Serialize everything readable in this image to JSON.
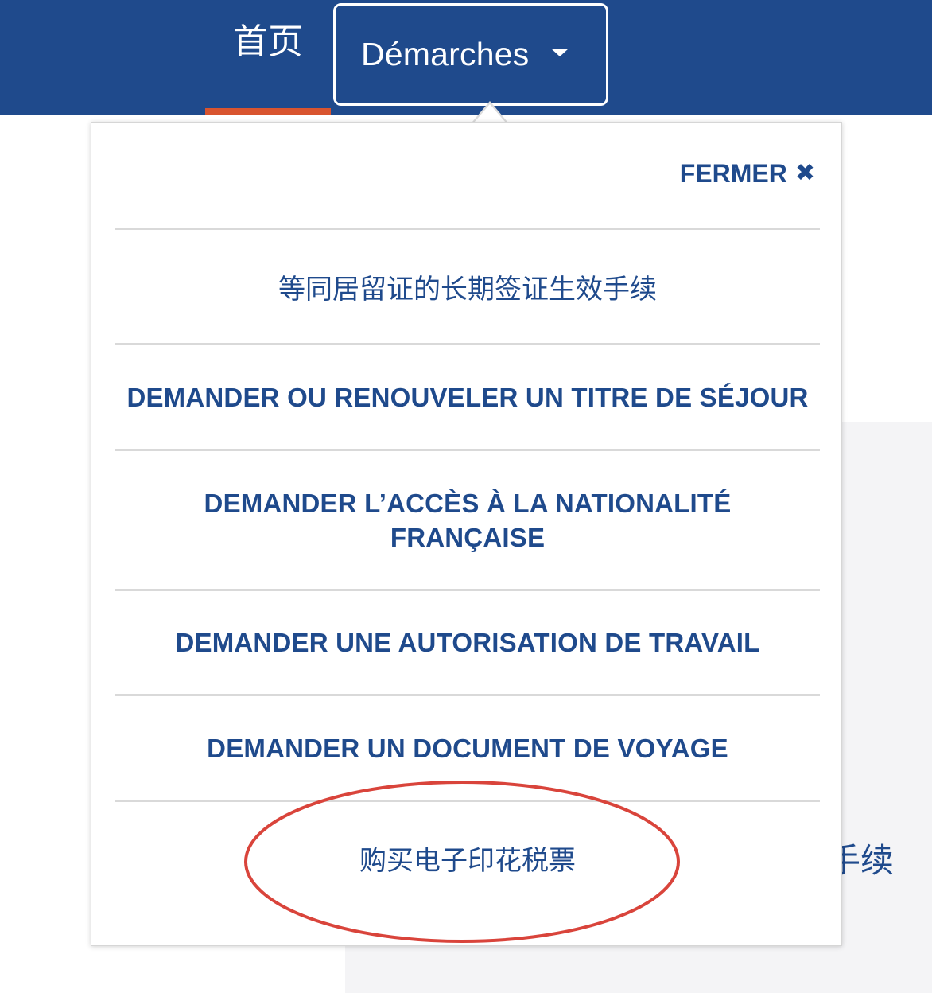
{
  "nav": {
    "home_label": "首页",
    "demarches_label": "Démarches"
  },
  "dropdown": {
    "close_label": "FERMER",
    "close_icon": "✖",
    "items": [
      {
        "label": "等同居留证的长期签证生效手续"
      },
      {
        "label": "DEMANDER OU RENOUVELER UN TITRE DE SÉJOUR"
      },
      {
        "label_line1": "DEMANDER L’ACCÈS À LA NATIONALITÉ",
        "label_line2": "FRANÇAISE"
      },
      {
        "label": "DEMANDER UNE AUTORISATION DE TRAVAIL"
      },
      {
        "label": "DEMANDER UN DOCUMENT DE VOYAGE"
      },
      {
        "label": "购买电子印花税票"
      }
    ]
  },
  "background": {
    "partial_text": "手续"
  },
  "colors": {
    "brand_blue": "#1f4a8c",
    "active_underline": "#d8542f",
    "annotation_red": "#d9443b"
  }
}
